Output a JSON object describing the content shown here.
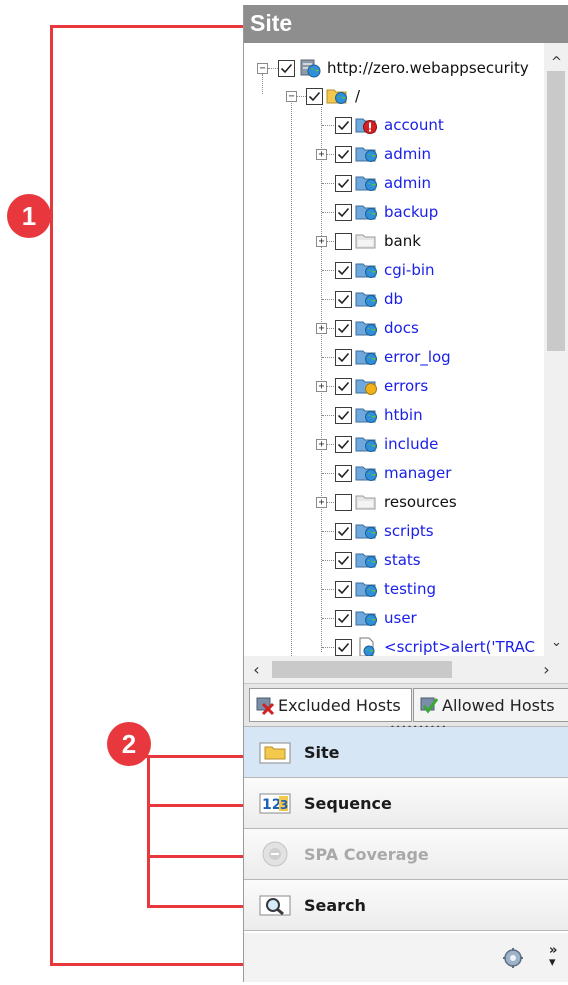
{
  "callouts": {
    "one": "1",
    "two": "2"
  },
  "header": {
    "title": "Site"
  },
  "tree": {
    "root": {
      "label": "http://zero.webappsecurity"
    },
    "dir": {
      "label": "/"
    },
    "items": [
      {
        "label": "account",
        "checked": true,
        "icon": "folder-error-icon",
        "link": true,
        "expandable": false
      },
      {
        "label": "admin",
        "checked": true,
        "icon": "folder-globe-icon",
        "link": true,
        "expandable": true
      },
      {
        "label": "admin",
        "checked": true,
        "icon": "folder-globe-icon",
        "link": true,
        "expandable": false
      },
      {
        "label": "backup",
        "checked": true,
        "icon": "folder-globe-icon",
        "link": true,
        "expandable": false
      },
      {
        "label": "bank",
        "checked": false,
        "icon": "folder-gray-icon",
        "link": false,
        "expandable": true
      },
      {
        "label": "cgi-bin",
        "checked": true,
        "icon": "folder-globe-icon",
        "link": true,
        "expandable": false
      },
      {
        "label": "db",
        "checked": true,
        "icon": "folder-globe-icon",
        "link": true,
        "expandable": false
      },
      {
        "label": "docs",
        "checked": true,
        "icon": "folder-globe-icon",
        "link": true,
        "expandable": true
      },
      {
        "label": "error_log",
        "checked": true,
        "icon": "folder-globe-icon",
        "link": true,
        "expandable": false
      },
      {
        "label": "errors",
        "checked": true,
        "icon": "folder-warning-icon",
        "link": true,
        "expandable": true
      },
      {
        "label": "htbin",
        "checked": true,
        "icon": "folder-globe-icon",
        "link": true,
        "expandable": false
      },
      {
        "label": "include",
        "checked": true,
        "icon": "folder-globe-icon",
        "link": true,
        "expandable": true
      },
      {
        "label": "manager",
        "checked": true,
        "icon": "folder-globe-icon",
        "link": true,
        "expandable": false
      },
      {
        "label": "resources",
        "checked": false,
        "icon": "folder-gray-icon",
        "link": false,
        "expandable": true
      },
      {
        "label": "scripts",
        "checked": true,
        "icon": "folder-globe-icon",
        "link": true,
        "expandable": false
      },
      {
        "label": "stats",
        "checked": true,
        "icon": "folder-globe-icon",
        "link": true,
        "expandable": false
      },
      {
        "label": "testing",
        "checked": true,
        "icon": "folder-globe-icon",
        "link": true,
        "expandable": false
      },
      {
        "label": "user",
        "checked": true,
        "icon": "folder-globe-icon",
        "link": true,
        "expandable": false
      },
      {
        "label": "<script>alert('TRAC",
        "checked": true,
        "icon": "file-globe-icon",
        "link": true,
        "expandable": false
      }
    ]
  },
  "tabs": {
    "excluded": {
      "label": "Excluded Hosts"
    },
    "allowed": {
      "label": "Allowed Hosts"
    }
  },
  "nav": {
    "site": {
      "label": "Site"
    },
    "sequence": {
      "label": "Sequence"
    },
    "spa": {
      "label": "SPA Coverage"
    },
    "search": {
      "label": "Search"
    }
  },
  "colors": {
    "annotation": "#e8383d",
    "link": "#1a20e8",
    "header": "#8e8e8e",
    "active_nav": "#d6e6f5"
  }
}
